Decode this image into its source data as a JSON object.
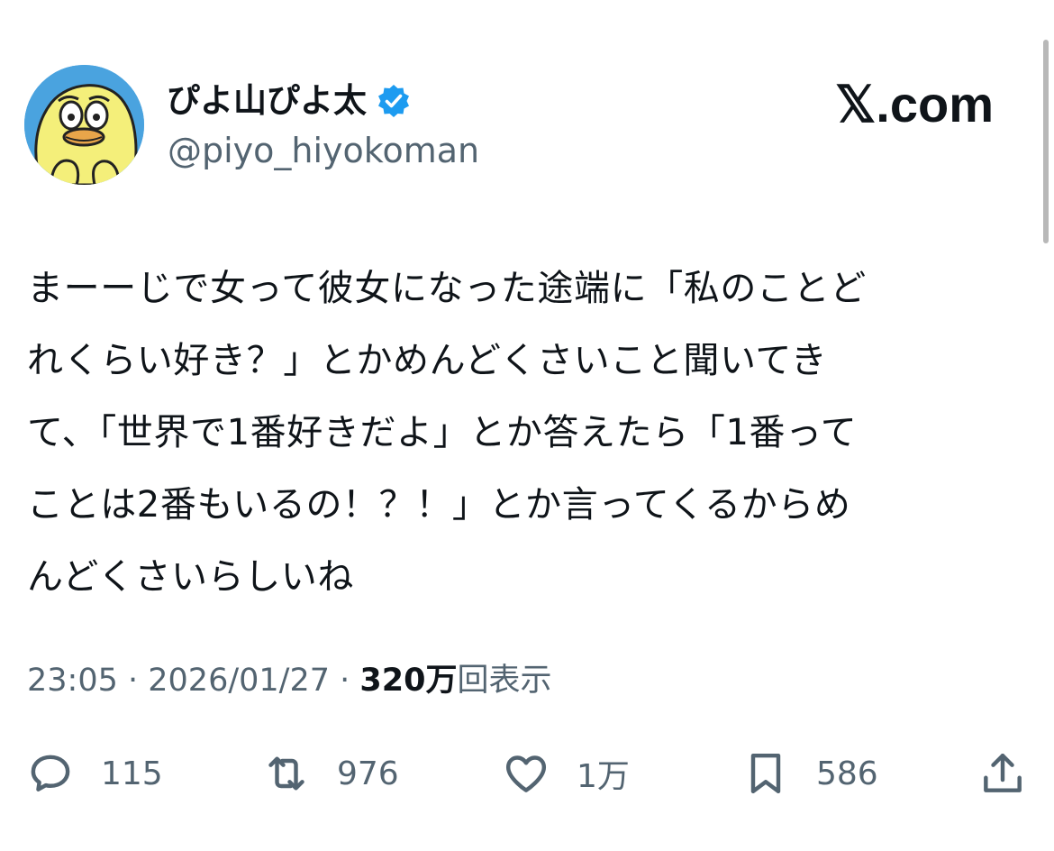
{
  "author": {
    "display_name": "ぴよ山ぴよ太",
    "handle": "@piyo_hiyokoman",
    "verified": true
  },
  "brand": "𝕏.com",
  "tweet": {
    "text": "まーーじで女って彼女になった途端に「私のことど\nれくらい好き？」とかめんどくさいこと聞いてき\nて、「世界で1番好きだよ」とか答えたら「1番って\nことは2番もいるの！？！」とか言ってくるからめ\nんどくさいらしいね",
    "time": "23:05",
    "separator": " · ",
    "date": "2026/01/27",
    "views_count": "320万",
    "views_label": "回表示"
  },
  "actions": {
    "replies": "115",
    "reposts": "976",
    "likes": "1万",
    "bookmarks": "586"
  },
  "colors": {
    "text": "#0f1419",
    "secondary": "#536471",
    "verified": "#1d9bf0",
    "avatar_bg": "#4aa3df",
    "avatar_char": "#f4ef7a"
  },
  "icons": {
    "verified": "verified-badge-icon",
    "reply": "reply-icon",
    "repost": "repost-icon",
    "like": "heart-icon",
    "bookmark": "bookmark-icon",
    "share": "share-icon"
  }
}
